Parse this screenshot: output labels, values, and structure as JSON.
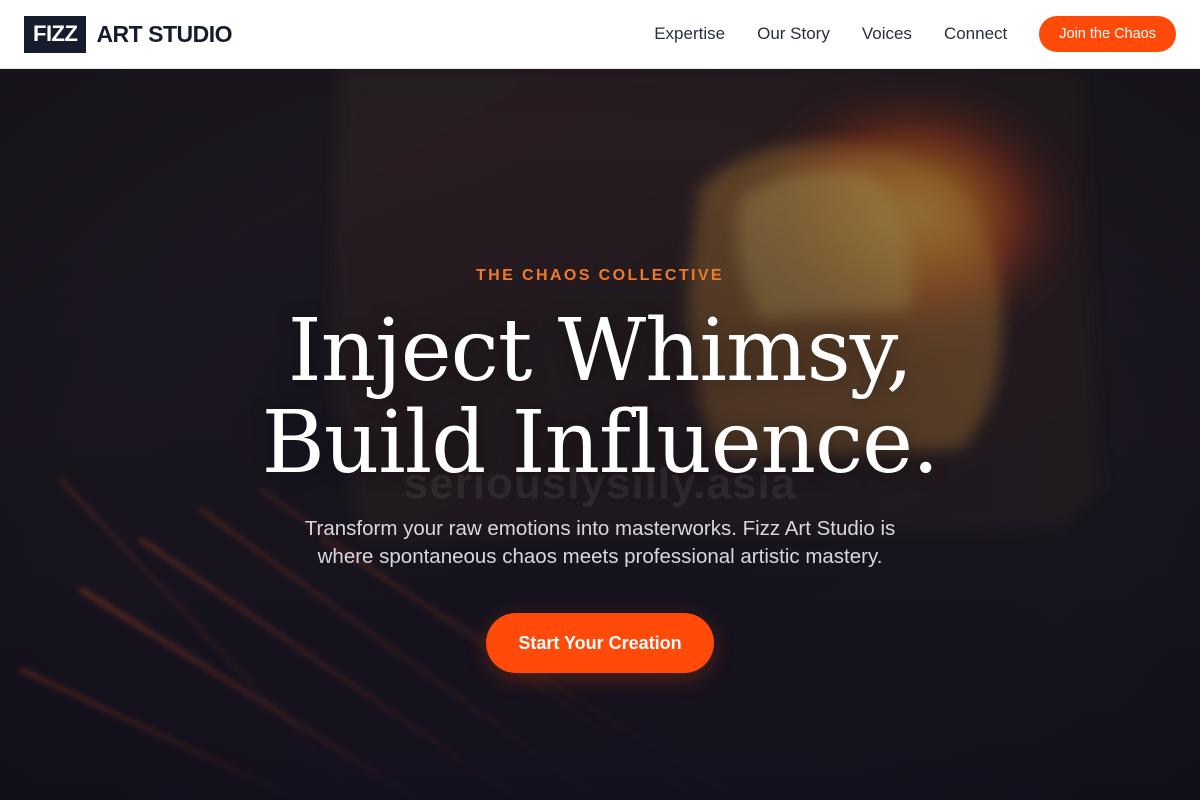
{
  "brand": {
    "mark": "FIZZ",
    "name": "ART STUDIO"
  },
  "nav": {
    "links": [
      "Expertise",
      "Our Story",
      "Voices",
      "Connect"
    ],
    "cta": "Join the Chaos"
  },
  "hero": {
    "eyebrow": "THE CHAOS COLLECTIVE",
    "headline_line1": "Inject Whimsy,",
    "headline_line2": "Build Influence.",
    "subtitle": "Transform your raw emotions into masterworks. Fizz Art Studio is where spontaneous chaos meets professional artistic mastery.",
    "cta": "Start Your Creation",
    "watermark": "seriouslysilly.asia"
  },
  "colors": {
    "accent": "#ff4a0a",
    "eyebrow": "#f07a2a",
    "navy": "#161b2e",
    "hero_bg": "#1b1721"
  }
}
